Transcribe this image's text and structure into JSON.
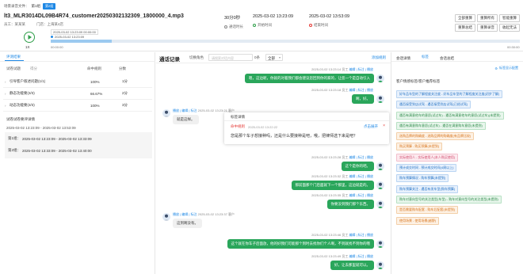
{
  "header": {
    "page_label": "场景录音文件：",
    "page_current": "第1组",
    "page_tag": "第2组",
    "file_title": "lt3_MLR3014DL09B4R74_customer20250302132309_1800000_4.mp3",
    "employee_line": "员工：某某某",
    "region_line": "门店：上海某4店",
    "stats": [
      {
        "value": "30分0秒",
        "label": "通话时长",
        "dot_color": "#888888"
      },
      {
        "value": "2025-03-02 13:23:09",
        "label": "开始时间",
        "dot_color": "#2e9e49"
      },
      {
        "value": "2025-03-02 13:53:09",
        "label": "结束时间",
        "dot_color": "#e53935"
      }
    ],
    "buttons_row1": [
      "全部重算",
      "重算所有",
      "智能重算"
    ],
    "buttons_row2": [
      "重算总结",
      "重算录音",
      "收起无法"
    ]
  },
  "player": {
    "play_label": "1X",
    "tooltip_time": "2025-03-02 13:23:09 00:00:00",
    "marker_time": "2025-03-02 13:23:09",
    "start_time": "00:00:00",
    "end_time": "00:30:00",
    "progress": 0.13
  },
  "left": {
    "tab_active": "评测结果",
    "table_headers": [
      "试卷试题",
      "得分",
      "命中规则",
      "分数"
    ],
    "rows": [
      {
        "name": "引导客户叙述问题(1/1)",
        "rate": "100%",
        "score": "1分"
      },
      {
        "name": "静态功能要(3/3)",
        "rate": "66.67%",
        "score": "2分"
      },
      {
        "name": "动态功能要(3/3)",
        "rate": "100%",
        "score": "3分"
      }
    ],
    "detail_title": "试卷试卷要评详情",
    "detail_time": "2025-03-02 13:23:09 - 2025-03-02 13:53:09",
    "details": [
      {
        "label": "第1组：",
        "value": "2025-03-02 13:23:09 - 2025-03-02 13:33:09"
      },
      {
        "label": "第2组：",
        "value": "2025-03-02 13:33:09 - 2025-03-02 13:40:00"
      }
    ]
  },
  "middle": {
    "title": "通话记录",
    "role_switch": "切换角色",
    "search_placeholder": "请搜索对话内容",
    "search_count": "0条",
    "filter_label": "全部",
    "add_label": "添加规则",
    "popup": {
      "title": "标签详情",
      "hit_label": "命中规则",
      "hit_time": "2025-03-02 13:22:22",
      "link_label": "点击展开",
      "content": "您是那个车子想接种吗，还是什么要接种是吧，哦，把律师选下来是吧？"
    },
    "messages": [
      {
        "side": "right",
        "time": "2025-03-02 13:23:14",
        "role": "员工",
        "actions": "编辑 | 标注 | 播放",
        "text": "嗯，这边呢，你就的对着我们都会建议您回到你的家的，让您一个是自动引入"
      },
      {
        "side": "right",
        "time": "2025-03-02 13:23:18",
        "role": "员工",
        "actions": "编辑 | 标注 | 播放",
        "text": "啊，好。"
      },
      {
        "side": "left",
        "time": "2025-03-02 13:23:21",
        "role": "客户",
        "actions": "播放 | 编辑 | 标注",
        "text": "就是这样。"
      },
      {
        "side": "right",
        "time": "2025-03-02 13:23:28",
        "role": "员工",
        "actions": "编辑 | 标注 | 播放",
        "text": "这个是你的吧。"
      },
      {
        "side": "right",
        "time": "2025-03-02 13:23:32",
        "role": "员工",
        "actions": "编辑 | 标注 | 播放",
        "text": "那前面那个门后面就下一个那里，这边就是的。"
      },
      {
        "side": "right",
        "time": "2025-03-02 13:23:35",
        "role": "员工",
        "actions": "编辑 | 标注 | 播放",
        "text": "你要没到我们那个东西。"
      },
      {
        "side": "left",
        "time": "2025-03-02 13:23:37",
        "role": "客户",
        "actions": "播放 | 编辑 | 标注",
        "text": "这到啊没有。"
      },
      {
        "side": "right",
        "time": "2025-03-02 13:23:46",
        "role": "员工",
        "actions": "编辑 | 标注 | 播放",
        "text": "这个就在你车子后面放，他的好我们可能那个到时去找你们个人啊，不到就找不到你的哦"
      },
      {
        "side": "right",
        "time": "2025-03-02 13:23:49",
        "role": "员工",
        "actions": "编辑 | 标注 | 播放",
        "text": "好，让去那里就可以。"
      }
    ]
  },
  "right": {
    "tabs": [
      "会话详情",
      "标签",
      "会话总结"
    ],
    "active_tab": "标签",
    "action_link": "标签显示配置",
    "section_title": "客户情感标签/客户推荐标签",
    "tags": [
      {
        "text": "好车品车型的了解程度关注度 - 好车品车型的了解程度关注度(初步了解)",
        "color": "blue"
      },
      {
        "text": "遇否接受到店试驾 - 遇否接受到店试驾(已经试驾)",
        "color": "blue"
      },
      {
        "text": "遇否有满意他车的意愿(试过车) - 遇否有满意他车的意愿(试过车)(未提到)",
        "color": "green"
      },
      {
        "text": "遇否有满意购车意愿(试过车) - 遇否在满意购车意愿(未提到)",
        "color": "green"
      },
      {
        "text": "选购品牌的购确度 - 选购品牌的购确度(有品牌比较)",
        "color": "orange"
      },
      {
        "text": "购买预算 - 购买预算(未提到)",
        "color": "orange"
      },
      {
        "text": "实际使用人 - 实际使用人(本人购买使用)",
        "color": "pink"
      },
      {
        "text": "预计成交时间 - 预计成交时间(4周以上)",
        "color": "blue"
      },
      {
        "text": "购车预算情况 - 购车预算(未提到)",
        "color": "blue"
      },
      {
        "text": "购车预算关注 - 遇否有发车型(购车预算)",
        "color": "blue"
      },
      {
        "text": "购车对意向型号的关注类型(车型) - 购车对意向型号的关注类型(未提到)",
        "color": "green"
      },
      {
        "text": "是否需要购车配套 - 购车后配套(未提到)",
        "color": "orange"
      },
      {
        "text": "使用场景 - 使用场景(越野)",
        "color": "orange"
      }
    ]
  }
}
